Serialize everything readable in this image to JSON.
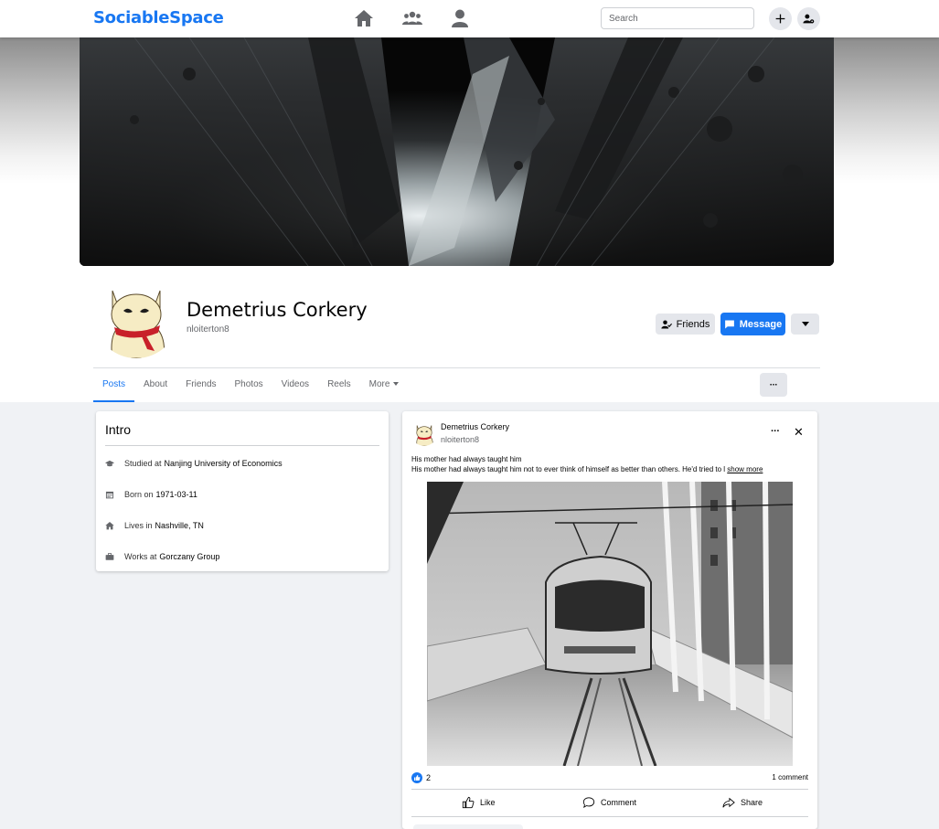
{
  "app": {
    "brand": "SociableSpace"
  },
  "nav": {
    "icons": [
      "home-icon",
      "friends-icon",
      "profile-icon"
    ],
    "search_placeholder": "Search",
    "right_icons": [
      "plus-icon",
      "account-settings-icon"
    ]
  },
  "profile": {
    "name": "Demetrius Corkery",
    "handle": "nloiterton8",
    "friends_label": "Friends",
    "message_label": "Message"
  },
  "tabs": [
    {
      "label": "Posts",
      "active": true
    },
    {
      "label": "About"
    },
    {
      "label": "Friends"
    },
    {
      "label": "Photos"
    },
    {
      "label": "Videos"
    },
    {
      "label": "Reels"
    },
    {
      "label": "More"
    }
  ],
  "tabs_more_button": "···",
  "intro": {
    "title": "Intro",
    "items": [
      {
        "icon": "graduation-cap-icon",
        "label": "Studied at",
        "value": "Nanjing University of Economics"
      },
      {
        "icon": "calendar-icon",
        "label": "Born on",
        "value": "1971-03-11"
      },
      {
        "icon": "home-icon",
        "label": "Lives in",
        "value": "Nashville, TN"
      },
      {
        "icon": "briefcase-icon",
        "label": "Works at",
        "value": "Gorczany Group"
      }
    ]
  },
  "post": {
    "author": "Demetrius Corkery",
    "handle": "nloiterton8",
    "menu": "···",
    "close": "✕",
    "title": "His mother had always taught him",
    "body": "His mother had always taught him not to ever think of himself as better than others. He'd tried to l",
    "show_more": "show more",
    "likes": "2",
    "comments": "1 comment",
    "actions": {
      "like": "Like",
      "comment": "Comment",
      "share": "Share"
    }
  },
  "colors": {
    "brand": "#1877f2",
    "background": "#f0f2f5"
  }
}
